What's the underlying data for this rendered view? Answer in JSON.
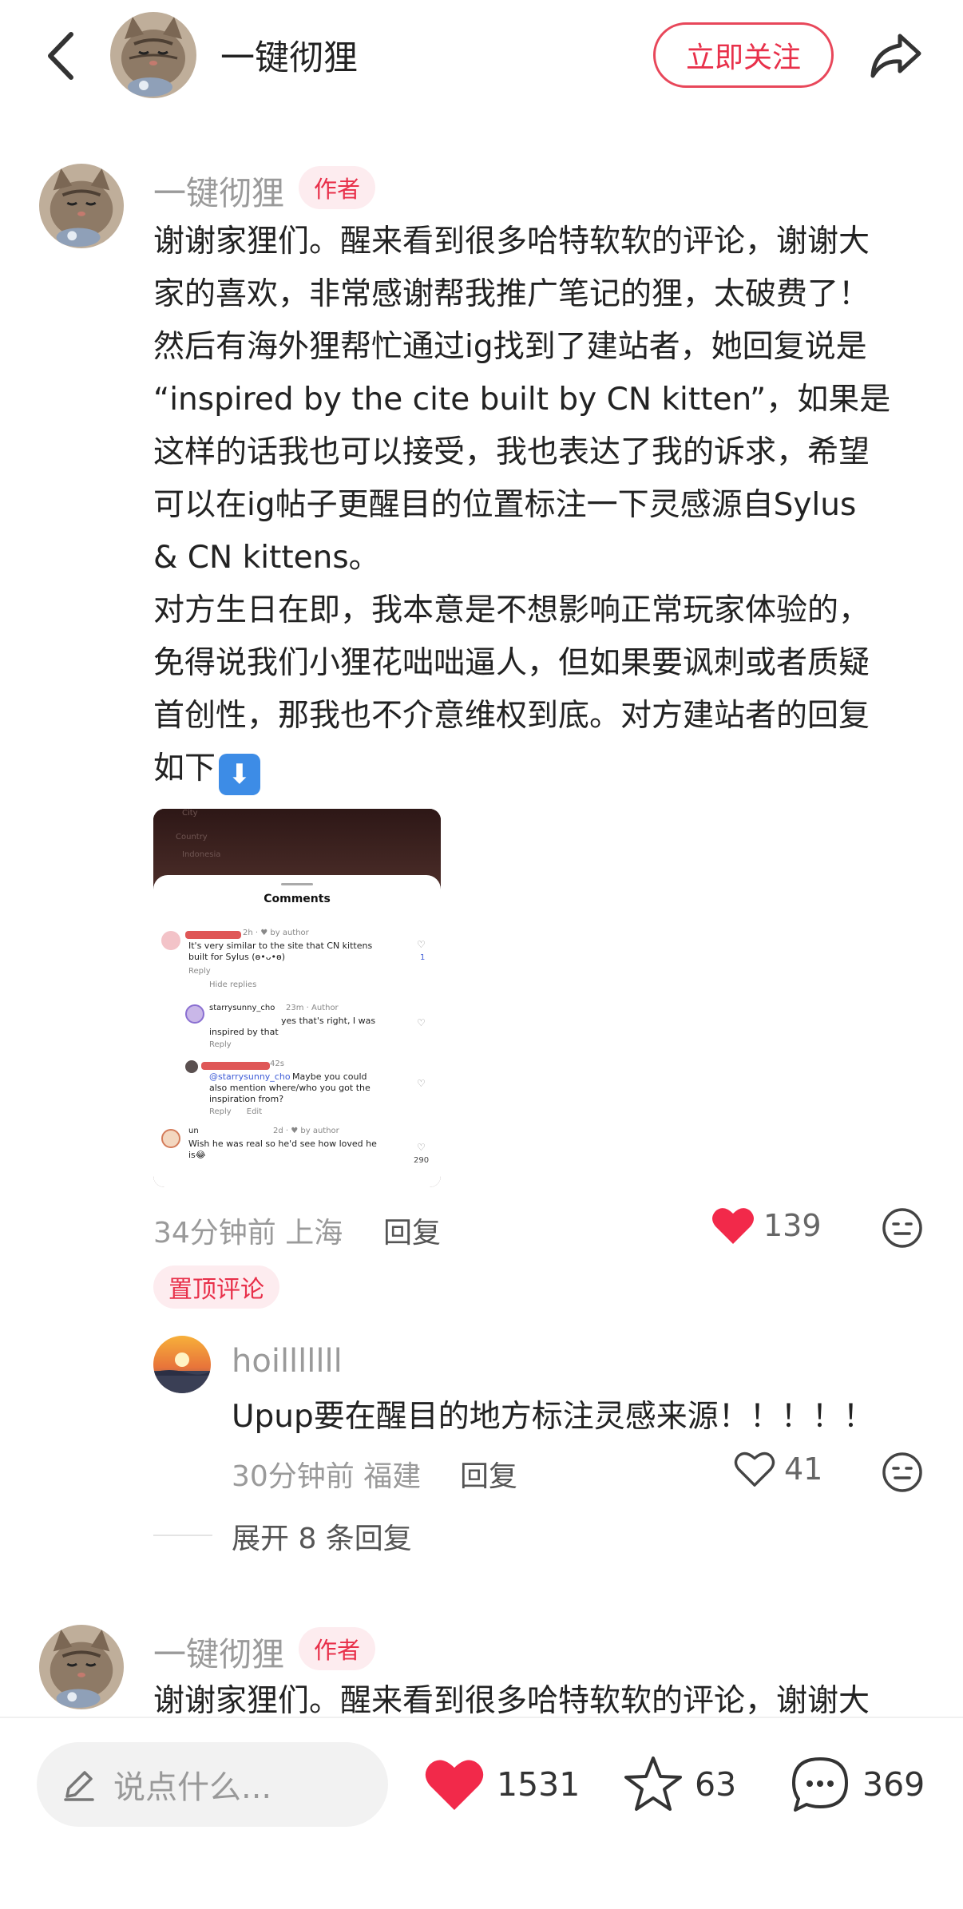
{
  "header": {
    "title": "一键彻狸",
    "follow_label": "立即关注"
  },
  "comment1": {
    "author": "一键彻狸",
    "author_tag": "作者",
    "lines": [
      "谢谢家狸们。醒来看到很多哈特软软的评论，谢谢大",
      "家的喜欢，非常感谢帮我推广笔记的狸，太破费了！",
      "然后有海外狸帮忙通过ig找到了建站者，她回复说是",
      "“inspired by the cite built by CN kitten”，如果是",
      "这样的话我也可以接受，我也表达了我的诉求，希望",
      "可以在ig帖子更醒目的位置标注一下灵感源自Sylus",
      "& CN kittens。",
      "对方生日在即，我本意是不想影响正常玩家体验的，",
      "免得说我们小狸花咄咄逼人，但如果要讽刺或者质疑",
      "首创性，那我也不介意维权到底。对方建站者的回复",
      "如下"
    ],
    "emoji": "⬇",
    "time_location": "34分钟前 上海",
    "reply_label": "回复",
    "like_count": "139",
    "pinned_tag": "置顶评论"
  },
  "attachment": {
    "top_text_1": "Country",
    "top_text_2": "Indonesia",
    "top_text_0": "City",
    "sheet_title": "Comments",
    "c1_meta": "2h · ♥ by author",
    "c1_text_1": "It's very similar to the site that CN kittens",
    "c1_text_2": "built for Sylus (ɵ•ᴗ•ɵ)",
    "c1_reply": "Reply",
    "c1_count": "1",
    "hide_replies": "Hide replies",
    "c2_user": "starrysunny_cho",
    "c2_meta": "23m · Author",
    "c2_text_1": "yes that's right, I was",
    "c2_text_2": "inspired by that",
    "c2_reply": "Reply",
    "c3_meta": "42s",
    "c3_mention": "@starrysunny_cho",
    "c3_text_1": "Maybe you could",
    "c3_text_2": "also mention where/who you got the",
    "c3_text_3": "inspiration from?",
    "c3_actions": "Reply      Edit",
    "c4_user": "un",
    "c4_meta": "2d · ♥ by author",
    "c4_text_1": "Wish he was real so he'd see how loved he",
    "c4_text_2": "is😂",
    "c4_count": "290"
  },
  "reply1": {
    "author": "hoilllllll",
    "text": "Upup要在醒目的地方标注灵感来源！！！！！",
    "time_location": "30分钟前 福建",
    "reply_label": "回复",
    "like_count": "41"
  },
  "expand_label": "展开 8 条回复",
  "comment2": {
    "author": "一键彻狸",
    "author_tag": "作者",
    "first_line": "谢谢家狸们。醒来看到很多哈特软软的评论，谢谢大"
  },
  "bottom_bar": {
    "input_placeholder": "说点什么...",
    "like_count": "1531",
    "collect_count": "63",
    "comment_count": "369"
  },
  "colors": {
    "accent": "#e8304a",
    "like_red": "#f2294a",
    "muted_text": "#9a9a9a"
  },
  "icons": [
    "back-icon",
    "share-icon",
    "heart-icon",
    "emoji-face-icon",
    "pencil-icon",
    "star-icon",
    "chat-bubble-icon"
  ]
}
